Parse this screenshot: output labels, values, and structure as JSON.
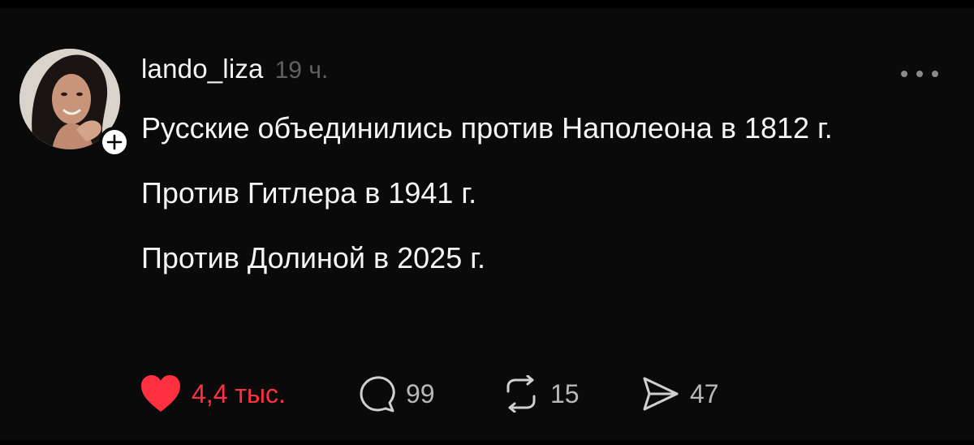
{
  "post": {
    "author": {
      "username": "lando_liza",
      "avatar_icon": "profile-photo",
      "follow_icon": "plus-icon"
    },
    "time": "19 ч.",
    "more_icon": "ellipsis-icon",
    "paragraphs": [
      "Русские объединились против Наполеона в 1812 г.",
      "Против Гитлера в 1941 г.",
      "Против Долиной в 2025 г."
    ],
    "actions": {
      "like": {
        "count": "4,4 тыс.",
        "icon": "heart-filled-icon",
        "liked": true,
        "color": "#ff3040"
      },
      "comment": {
        "count": "99",
        "icon": "comment-bubble-icon"
      },
      "repost": {
        "count": "15",
        "icon": "repost-icon"
      },
      "share": {
        "count": "47",
        "icon": "send-icon"
      }
    }
  },
  "colors": {
    "background": "#0a0a0a",
    "text": "#f3f5f7",
    "muted": "#616161",
    "like": "#ff3040"
  }
}
